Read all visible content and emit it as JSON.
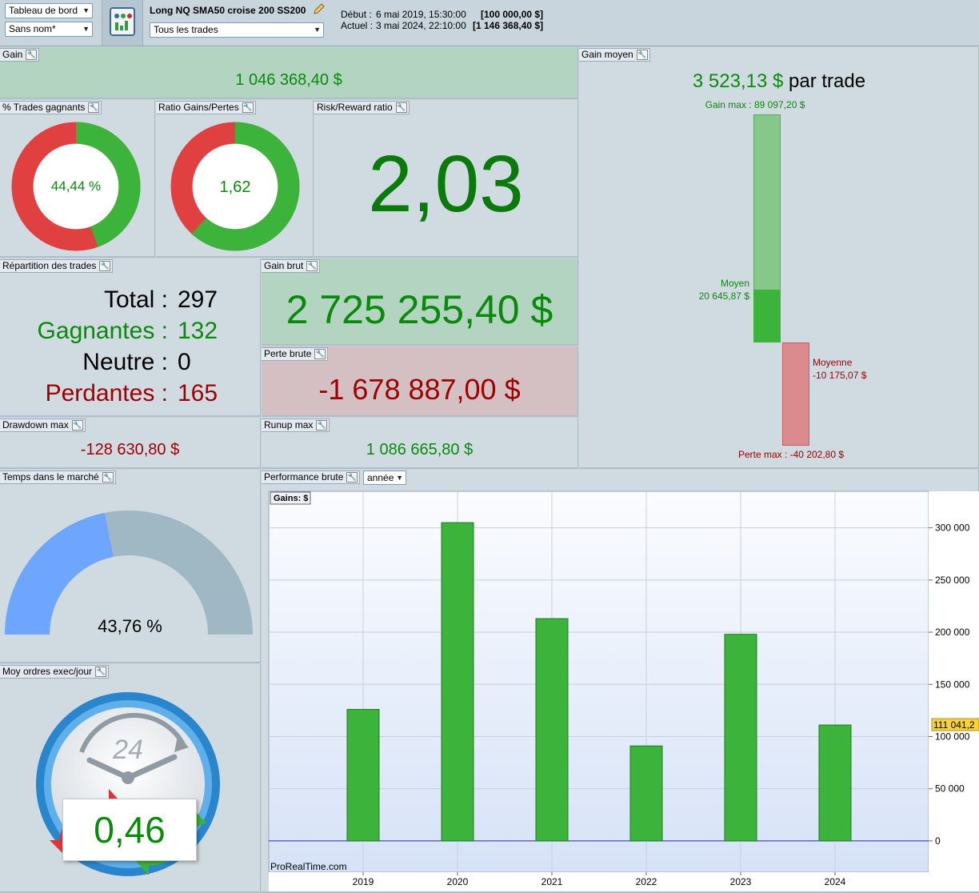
{
  "toolbar": {
    "view_select": "Tableau de bord",
    "name_select": "Sans nom*",
    "system_name": "Long NQ SMA50 croise 200 SS200",
    "trades_filter": "Tous les trades",
    "start_label": "Début :",
    "start_value": "6 mai 2019, 15:30:00",
    "start_capital": "[100 000,00 $]",
    "current_label": "Actuel :",
    "current_value": "3 mai 2024, 22:10:00",
    "current_capital": "[1 146 368,40 $]"
  },
  "gain": {
    "title": "Gain",
    "value": "1 046 368,40 $"
  },
  "pct_winning": {
    "title": "% Trades gagnants",
    "value": "44,44 %",
    "fraction": 0.4444
  },
  "ratio_gains": {
    "title": "Ratio Gains/Pertes",
    "value": "1,62",
    "fraction": 0.618
  },
  "risk_reward": {
    "title": "Risk/Reward ratio",
    "value": "2,03"
  },
  "repartition": {
    "title": "Répartition des trades",
    "total_label": "Total :",
    "total_value": "297",
    "win_label": "Gagnantes :",
    "win_value": "132",
    "neutral_label": "Neutre :",
    "neutral_value": "0",
    "loss_label": "Perdantes :",
    "loss_value": "165"
  },
  "gross_gain": {
    "title": "Gain brut",
    "value": "2 725 255,40 $"
  },
  "gross_loss": {
    "title": "Perte brute",
    "value": "-1 678 887,00 $"
  },
  "drawdown": {
    "title": "Drawdown max",
    "value": "-128 630,80 $"
  },
  "runup": {
    "title": "Runup max",
    "value": "1 086 665,80 $"
  },
  "avg_gain": {
    "title": "Gain moyen",
    "value": "3 523,13 $",
    "suffix": "par trade",
    "max_gain_label": "Gain max : 89 097,20 $",
    "avg_win_label": "Moyen",
    "avg_win_value": "20 645,87 $",
    "avg_loss_label": "Moyenne",
    "avg_loss_value": "-10 175,07 $",
    "max_loss_label": "Perte max : -40 202,80 $",
    "max_gain": 89097.2,
    "avg_win": 20645.87,
    "avg_loss": -10175.07,
    "max_loss": -40202.8
  },
  "time_in_market": {
    "title": "Temps dans le marché",
    "value": "43,76 %",
    "fraction": 0.4376
  },
  "orders_per_day": {
    "title": "Moy ordres exec/jour",
    "clock_label": "24",
    "value": "0,46"
  },
  "performance": {
    "title": "Performance brute",
    "period_select": "année",
    "axis_title": "Gains: $",
    "watermark": "ProRealTime.com",
    "last_value_label": "111 041,2"
  },
  "colors": {
    "win": "#3cb43c",
    "loss": "#e04040",
    "text_green": "#0a8a0a",
    "text_red": "#a00000"
  },
  "chart_data": {
    "type": "bar",
    "categories": [
      "2019",
      "2020",
      "2021",
      "2022",
      "2023",
      "2024"
    ],
    "values": [
      126000,
      305000,
      213000,
      91000,
      198000,
      111041.2
    ],
    "ylim": [
      -30000,
      335000
    ],
    "yticks": [
      0,
      50000,
      100000,
      150000,
      200000,
      250000,
      300000
    ],
    "ytick_labels": [
      "0",
      "50 000",
      "100 000",
      "150 000",
      "200 000",
      "250 000",
      "300 000"
    ],
    "ylabel": "Gains: $",
    "grid": true
  }
}
